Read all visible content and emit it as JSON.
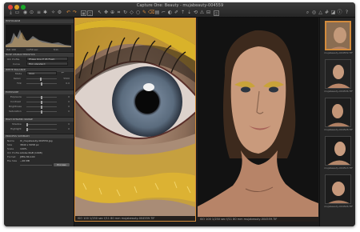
{
  "window": {
    "title": "Capture One: Beauty - mujabeauty-004559"
  },
  "toolbar": {
    "icons": [
      "import-icon",
      "folder-icon",
      "capture-icon",
      "recent-icon",
      "undo-icon",
      "redo-icon",
      "auto-adjust-icon",
      "reset-icon",
      "cursor-icon",
      "crop-icon",
      "rotate-icon",
      "eyedropper-icon",
      "brush-icon",
      "spot-icon",
      "grid-icon",
      "loupe-icon",
      "overlay-icon",
      "proof-icon",
      "help-icon"
    ]
  },
  "sidebar": {
    "histogram": {
      "title": "HISTOGRAM"
    },
    "sections": {
      "base": "BASE CHARACTERISTICS",
      "wb": "WHITE BALANCE",
      "exposure": "EXPOSURE",
      "hdr": "HIGH DYNAMIC RANGE",
      "summary": "PROCESS SUMMARY"
    },
    "hist_readout": {
      "iso": "ISO 100",
      "shutter": "1/250 sec",
      "aperture": "f/11"
    },
    "base": {
      "profile_label": "ICC Profile",
      "profile_value": "Phase One P 45 Flash",
      "curve_label": "Curve",
      "curve_value": "Film standard"
    },
    "wb": {
      "mode_label": "Mode",
      "mode_value": "Shot",
      "kelvin_label": "Kelvin",
      "kelvin_value": "5500",
      "tint_label": "Tint",
      "tint_value": "0.0"
    },
    "exposure": {
      "rows": [
        {
          "label": "Exposure",
          "value": "0"
        },
        {
          "label": "Contrast",
          "value": "0"
        },
        {
          "label": "Brightness",
          "value": "0"
        },
        {
          "label": "Saturation",
          "value": "0"
        }
      ]
    },
    "hdr": {
      "rows": [
        {
          "label": "Shadow",
          "value": "0"
        },
        {
          "label": "Highlight",
          "value": "0"
        }
      ]
    },
    "summary": {
      "rows": [
        {
          "label": "Name",
          "value": "IC_mujabeauty-004559.jpg"
        },
        {
          "label": "Size",
          "value": "3840 x 5058 px"
        },
        {
          "label": "Scale",
          "value": "100%"
        },
        {
          "label": "ICC Profile",
          "value": "Adobe RGB (1998)"
        },
        {
          "label": "Format",
          "value": "JPEG 80-100"
        },
        {
          "label": "File Size",
          "value": "~26 MB"
        }
      ],
      "process_label": "Process"
    }
  },
  "viewer_left": {
    "info": "ISO 100   1/250 sec   f/11   80 mm   mujabeauty-004559.TIF"
  },
  "viewer_right": {
    "info": "ISO 100   1/250 sec   f/11   80 mm   mujabeauty-004559.TIF"
  },
  "filmstrip": {
    "thumbs": [
      {
        "caption": "mujabeauty-004559.TIF"
      },
      {
        "caption": "mujabeauty-004536.TIF"
      },
      {
        "caption": "mujabeauty-004528.TIF"
      },
      {
        "caption": "mujabeauty-004513.TIF"
      },
      {
        "caption": "mujabeauty-004546.TIF"
      }
    ]
  },
  "colors": {
    "accent": "#d38b3c",
    "eyeshadow": "#d4a816"
  }
}
